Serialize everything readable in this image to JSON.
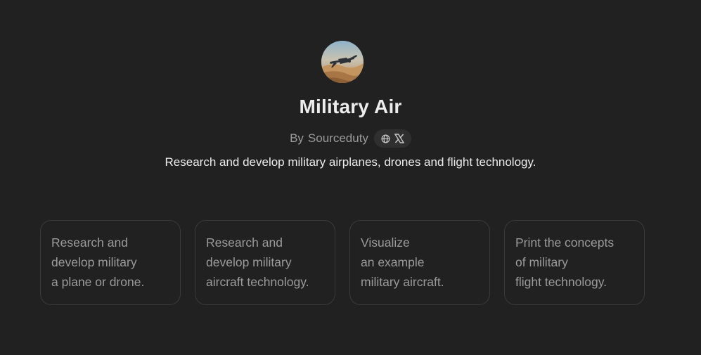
{
  "gpt": {
    "title": "Military Air",
    "author_prefix": "By",
    "author": "Sourceduty",
    "description": "Research and develop military airplanes, drones and flight technology."
  },
  "social_icons": [
    "globe-icon",
    "x-icon"
  ],
  "starters": [
    {
      "lines": [
        "Research and",
        "develop military",
        "a plane or drone."
      ]
    },
    {
      "lines": [
        "Research and",
        "develop military",
        "aircraft technology."
      ]
    },
    {
      "lines": [
        "Visualize",
        "an example",
        "military aircraft."
      ]
    },
    {
      "lines": [
        "Print the concepts",
        "of military",
        "flight technology."
      ]
    }
  ],
  "colors": {
    "background": "#212121",
    "title": "#ececec",
    "muted": "#9b9b9b",
    "card_border": "#3a3a3a",
    "badge_bg": "#2f2f2f"
  }
}
